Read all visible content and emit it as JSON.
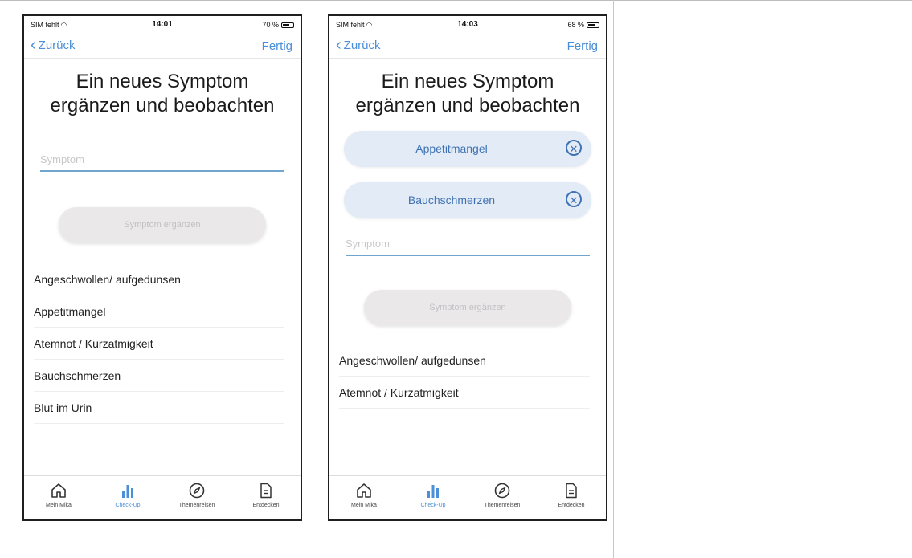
{
  "screen1": {
    "status": {
      "carrier": "SIM fehlt",
      "time": "14:01",
      "battery": "70 %",
      "battery_level": 0.7
    },
    "nav": {
      "back": "Zurück",
      "done": "Fertig"
    },
    "title_line1": "Ein neues Symptom",
    "title_line2": "ergänzen und beobachten",
    "input": {
      "placeholder": "Symptom",
      "value": ""
    },
    "add_button": "Symptom ergänzen",
    "list": [
      "Angeschwollen/ aufgedunsen",
      "Appetitmangel",
      "Atemnot / Kurzatmigkeit",
      "Bauchschmerzen",
      "Blut im Urin"
    ]
  },
  "screen2": {
    "status": {
      "carrier": "SIM fehlt",
      "time": "14:03",
      "battery": "68 %",
      "battery_level": 0.68
    },
    "nav": {
      "back": "Zurück",
      "done": "Fertig"
    },
    "title_line1": "Ein neues Symptom",
    "title_line2": "ergänzen und beobachten",
    "chips": [
      "Appetitmangel",
      "Bauchschmerzen"
    ],
    "input": {
      "placeholder": "Symptom",
      "value": ""
    },
    "add_button": "Symptom ergänzen",
    "list": [
      "Angeschwollen/ aufgedunsen",
      "Atemnot / Kurzatmigkeit"
    ]
  },
  "tabbar": {
    "active": "Check-Up",
    "items": [
      {
        "label": "Mein Mika",
        "icon": "home-icon"
      },
      {
        "label": "Check-Up",
        "icon": "bar-chart-icon"
      },
      {
        "label": "Themenreisen",
        "icon": "compass-icon"
      },
      {
        "label": "Entdecken",
        "icon": "document-icon"
      }
    ]
  },
  "colors": {
    "accent": "#4b8fd8",
    "chip_bg": "#e3ebf6",
    "chip_text": "#3f73b5",
    "input_line": "#6fa6cf"
  }
}
